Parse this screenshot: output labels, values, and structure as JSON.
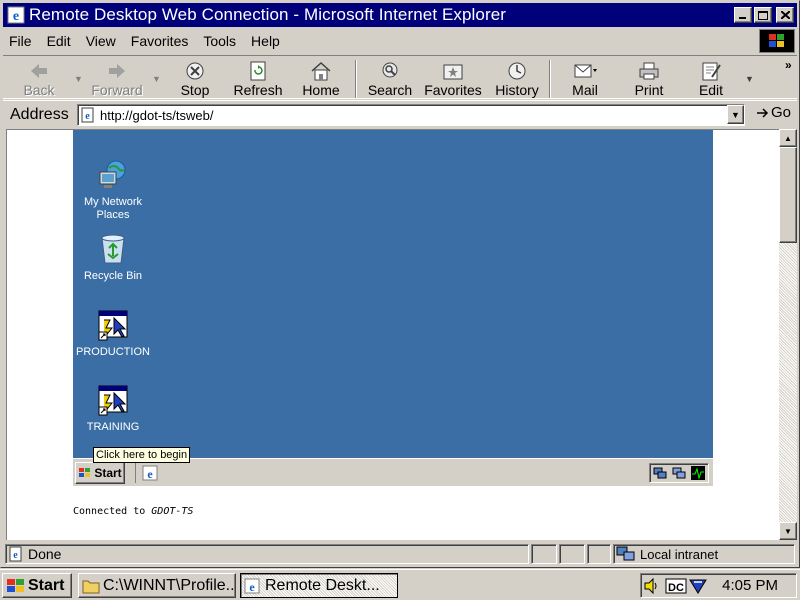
{
  "window": {
    "title": "Remote Desktop Web Connection - Microsoft Internet Explorer",
    "minimize": "_",
    "maximize": "□",
    "close": "X"
  },
  "menu": [
    "File",
    "Edit",
    "View",
    "Favorites",
    "Tools",
    "Help"
  ],
  "toolbar": {
    "back": "Back",
    "forward": "Forward",
    "stop": "Stop",
    "refresh": "Refresh",
    "home": "Home",
    "search": "Search",
    "favorites": "Favorites",
    "history": "History",
    "mail": "Mail",
    "print": "Print",
    "edit": "Edit",
    "more": "»"
  },
  "address": {
    "label": "Address",
    "url": "http://gdot-ts/tsweb/",
    "go": "Go"
  },
  "remote_desktop": {
    "icons": [
      {
        "label_line1": "My Network",
        "label_line2": "Places"
      },
      {
        "label_line1": "Recycle Bin",
        "label_line2": ""
      },
      {
        "label_line1": "PRODUCTION",
        "label_line2": ""
      },
      {
        "label_line1": "TRAINING",
        "label_line2": ""
      }
    ],
    "start": "Start",
    "tooltip": "Click here to begin"
  },
  "connected": {
    "prefix": "Connected to ",
    "server": "GDOT-TS"
  },
  "status": {
    "text": "Done",
    "zone": "Local intranet"
  },
  "taskbar": {
    "start": "Start",
    "tasks": [
      "C:\\WINNT\\Profile...",
      "Remote Deskt..."
    ],
    "clock": "4:05 PM"
  },
  "colors": {
    "titlebar": "#00007b",
    "desktop": "#3a6ea5",
    "chrome": "#d4d0c8"
  }
}
